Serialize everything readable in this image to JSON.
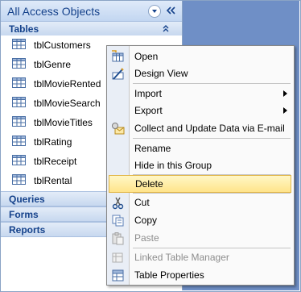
{
  "nav": {
    "title": "All Access Objects",
    "groups": {
      "tables": "Tables",
      "queries": "Queries",
      "forms": "Forms",
      "reports": "Reports"
    },
    "tables": [
      "tblCustomers",
      "tblGenre",
      "tblMovieRented",
      "tblMovieSearch",
      "tblMovieTitles",
      "tblRating",
      "tblReceipt",
      "tblRental"
    ]
  },
  "menu": {
    "open": "Open",
    "design_view": "Design View",
    "import": "Import",
    "export": "Export",
    "collect": "Collect and Update Data via E-mail",
    "rename": "Rename",
    "hide": "Hide in this Group",
    "delete": "Delete",
    "cut": "Cut",
    "copy": "Copy",
    "paste": "Paste",
    "linked_table_manager": "Linked Table Manager",
    "table_properties": "Table Properties"
  },
  "colors": {
    "accent_text": "#15428b",
    "highlight": "#ffe48a",
    "background_right": "#6f8fc6"
  }
}
